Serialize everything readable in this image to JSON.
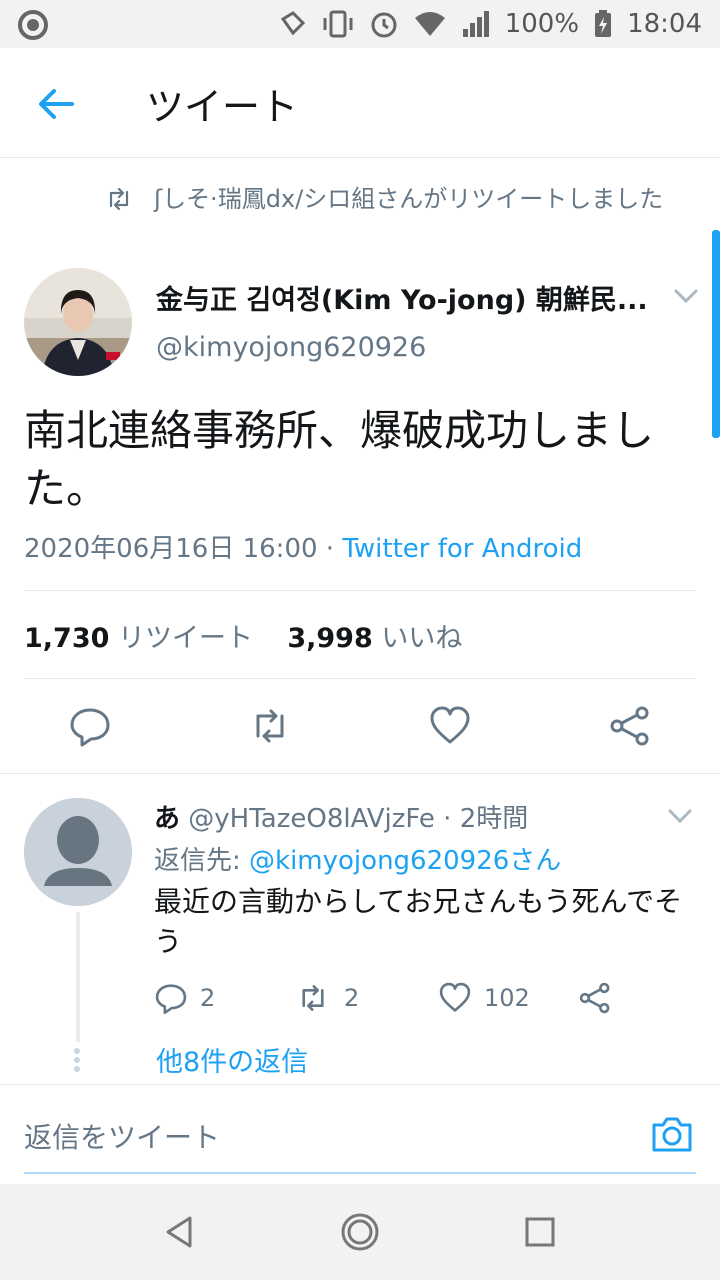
{
  "status_bar": {
    "battery": "100%",
    "time": "18:04"
  },
  "app_bar": {
    "title": "ツイート"
  },
  "retweet_header": {
    "text": "ʃしそ·瑞鳳dx/シロ組さんがリツイートしました"
  },
  "tweet": {
    "author_name": "金与正 김여정(Kim Yo-jong) 朝鮮民...",
    "author_handle": "@kimyojong620926",
    "text": "南北連絡事務所、爆破成功しました。",
    "datetime": "2020年06月16日 16:00",
    "separator": " · ",
    "source": "Twitter for Android",
    "retweet_count": "1,730",
    "retweet_label": "リツイート",
    "like_count": "3,998",
    "like_label": "いいね"
  },
  "reply": {
    "name": "あ",
    "handle": "@yHTazeO8lAVjzFe",
    "time": " · 2時間",
    "reply_to_label": "返信先: ",
    "reply_to_handle": "@kimyojong620926さん",
    "text": "最近の言動からしてお兄さんもう死んでそう",
    "reply_count": "2",
    "retweet_count": "2",
    "like_count": "102",
    "more_replies": "他8件の返信"
  },
  "compose": {
    "placeholder": "返信をツイート"
  },
  "colors": {
    "accent": "#1da1f2",
    "secondary_text": "#657786",
    "primary_text": "#14171a",
    "divider": "#e1e8ed"
  },
  "icons": {
    "back": "arrow-left-icon",
    "retweet": "retweet-icon",
    "reply": "comment-icon",
    "like": "heart-icon",
    "share": "share-icon",
    "chevron": "chevron-down-icon",
    "camera": "camera-icon"
  }
}
